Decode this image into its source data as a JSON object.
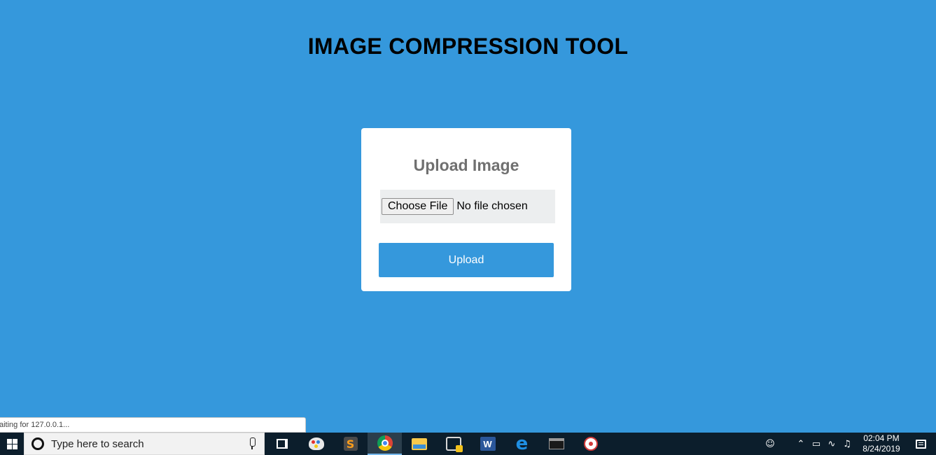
{
  "page": {
    "title": "IMAGE COMPRESSION TOOL"
  },
  "upload_card": {
    "heading": "Upload Image",
    "choose_file_label": "Choose File",
    "file_status": "No file chosen",
    "upload_label": "Upload"
  },
  "browser_status": {
    "text": "aiting for 127.0.0.1..."
  },
  "taskbar": {
    "search_placeholder": "Type here to search",
    "apps": [
      "task-view",
      "paint",
      "sublime-text",
      "chrome",
      "file-explorer",
      "python",
      "word",
      "edge",
      "terminal",
      "spider"
    ],
    "active_app": "chrome",
    "clock_time": "02:04 PM",
    "clock_date": "8/24/2019"
  },
  "colors": {
    "page_background": "#3598dc",
    "accent": "#3598dc",
    "taskbar": "#0c1e2c"
  }
}
